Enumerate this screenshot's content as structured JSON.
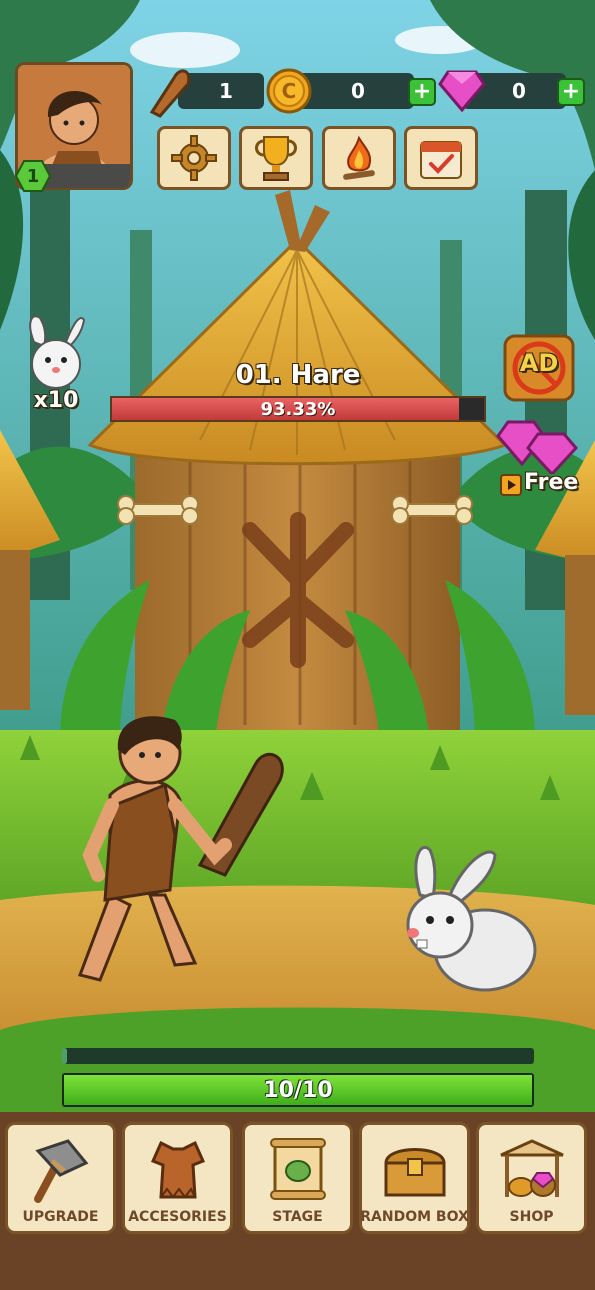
{
  "hud": {
    "player_level": "1",
    "club_count": "1",
    "coins": "0",
    "gems": "0",
    "coin_add_label": "+",
    "gem_add_label": "+"
  },
  "enemy": {
    "name": "01. Hare",
    "hp_percent_text": "93.33%",
    "hp_fraction": 0.9333,
    "remaining_label": "x10"
  },
  "side": {
    "ad_label": "AD",
    "free_label": "Free"
  },
  "stage_progress": {
    "text": "10/10",
    "fraction": 1.0,
    "exp_fraction": 0.01
  },
  "nav": [
    {
      "label": "UPGRADE",
      "icon": "stone-hammer-icon"
    },
    {
      "label": "ACCESORIES",
      "icon": "fur-tunic-icon"
    },
    {
      "label": "STAGE",
      "icon": "scroll-map-icon"
    },
    {
      "label": "RANDOM BOX",
      "icon": "treasure-chest-icon"
    },
    {
      "label": "SHOP",
      "icon": "market-stall-icon"
    }
  ],
  "colors": {
    "hp_red": "#d84848",
    "progress_green": "#5cc526",
    "plus_green": "#3cc238",
    "frame_brown": "#7a5326",
    "panel_cream": "#f4e6c3"
  }
}
